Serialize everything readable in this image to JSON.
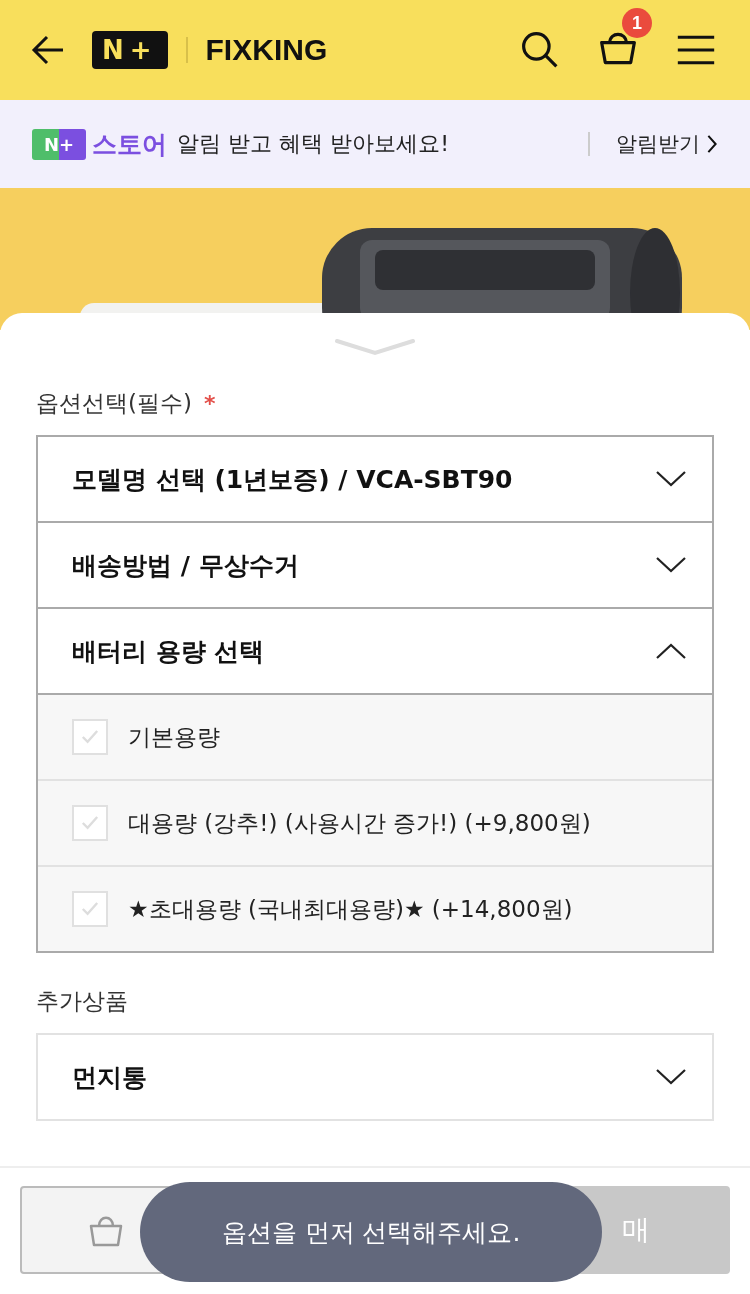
{
  "header": {
    "brand_badge": "N+",
    "brand": "FIXKING",
    "cart_count": "1"
  },
  "notice": {
    "store_badge": "N+",
    "store": "스토어",
    "message": "알림 받고 혜택 받아보세요!",
    "action": "알림받기"
  },
  "required_options": {
    "label": "옵션선택(필수)",
    "required_mark": "*",
    "selects": [
      {
        "label": "모델명 선택 (1년보증) / VCA-SBT90",
        "expanded": false
      },
      {
        "label": "배송방법 / 무상수거",
        "expanded": false
      },
      {
        "label": "배터리 용량 선택",
        "expanded": true,
        "options": [
          {
            "label": "기본용량",
            "checked": false
          },
          {
            "label": "대용량 (강추!) (사용시간 증가!) (+9,800원)",
            "checked": false
          },
          {
            "label": "★초대용량 (국내최대용량)★ (+14,800원)",
            "checked": false
          }
        ]
      }
    ]
  },
  "additional_products": {
    "label": "추가상품",
    "selects": [
      {
        "label": "먼지통",
        "expanded": false
      }
    ]
  },
  "bottom_bar": {
    "buy_button": "매"
  },
  "toast": "옵션을 먼저 선택해주세요."
}
